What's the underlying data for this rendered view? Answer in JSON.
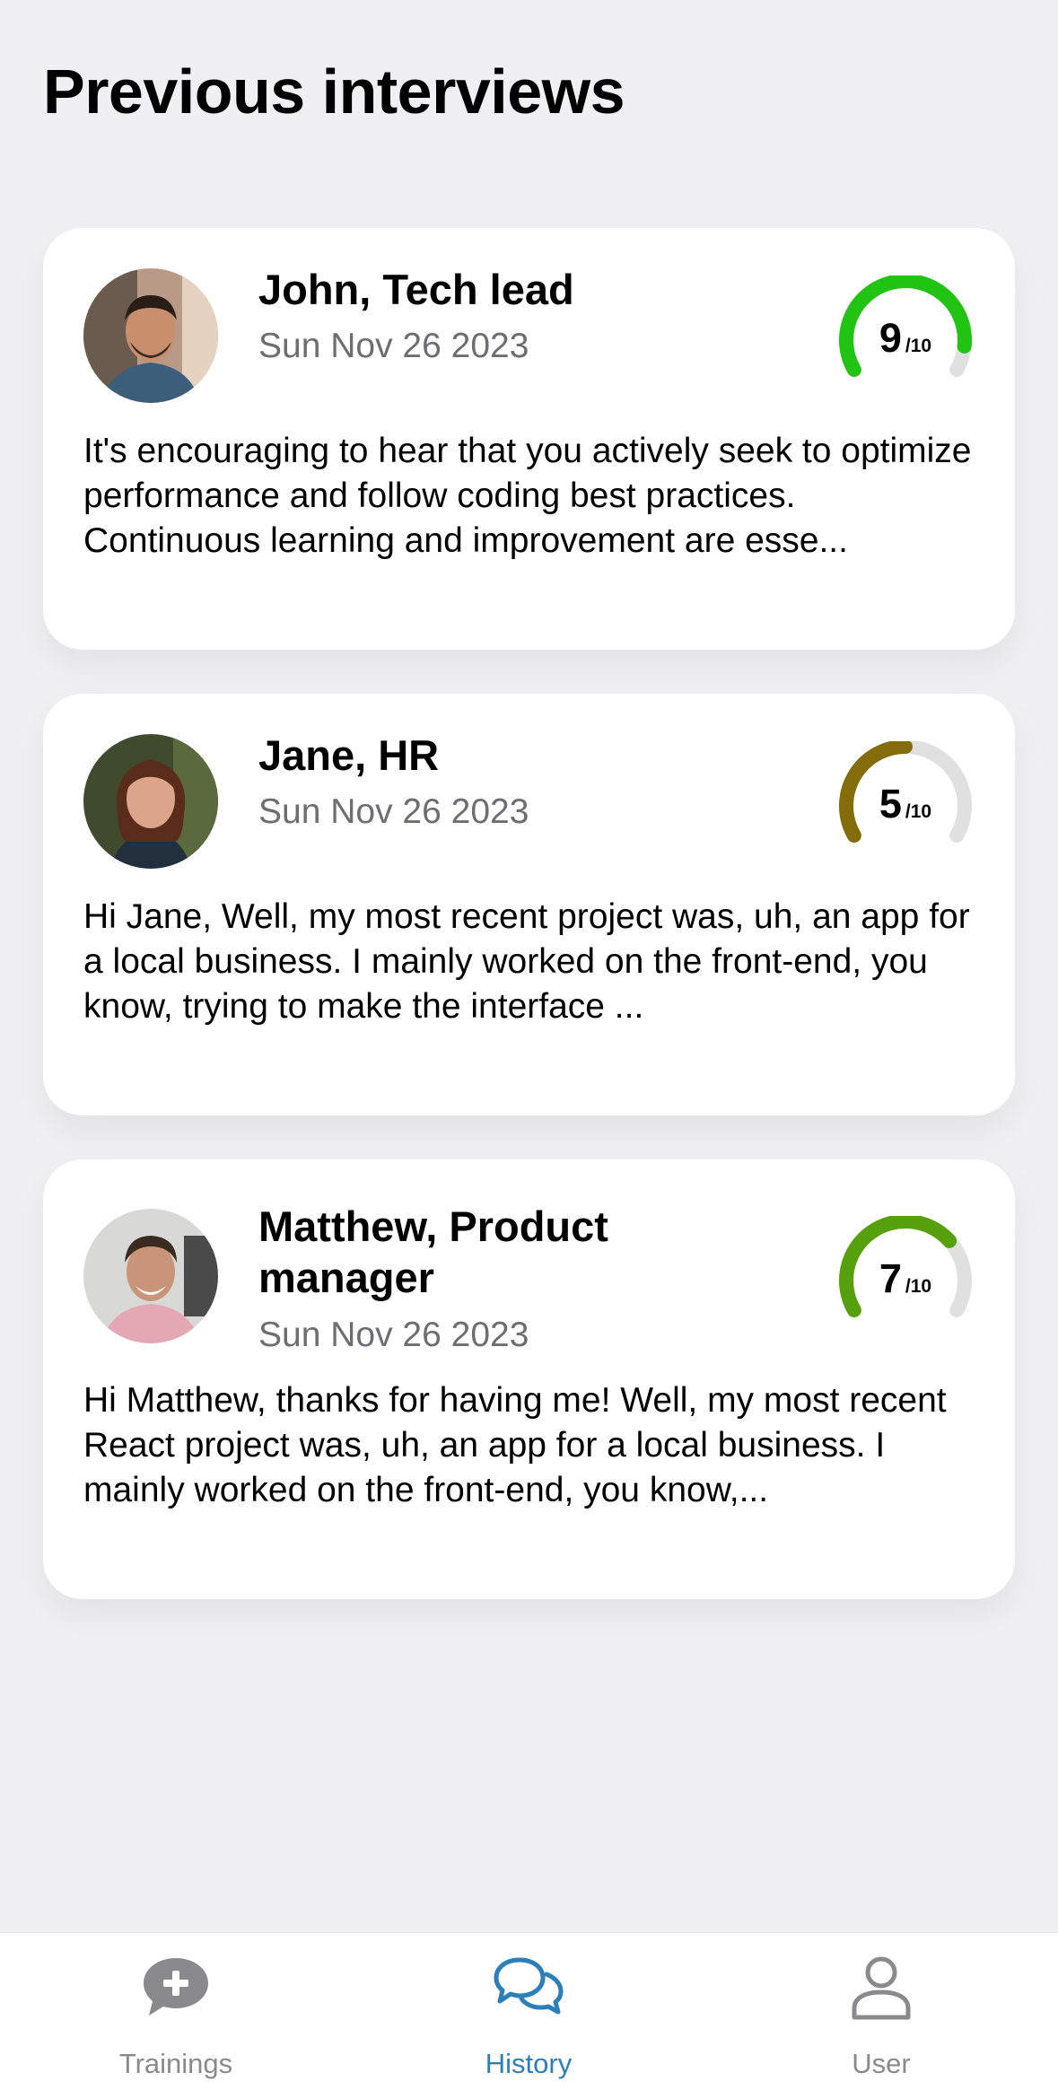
{
  "header": {
    "title": "Previous interviews"
  },
  "interviews": [
    {
      "name": "John, Tech lead",
      "date": "Sun Nov 26 2023",
      "score": "9",
      "score_max": "/10",
      "score_fraction": 0.9,
      "gauge_color": "#22c414",
      "snippet": "It's encouraging to hear that you actively seek to optimize performance and follow coding best practices. Continuous learning and improvement are esse..."
    },
    {
      "name": "Jane, HR",
      "date": "Sun Nov 26 2023",
      "score": "5",
      "score_max": "/10",
      "score_fraction": 0.5,
      "gauge_color": "#856c0a",
      "snippet": "Hi Jane,  Well, my most recent project was, uh, an app for a local business. I mainly worked on the front-end, you know, trying to make the interface ..."
    },
    {
      "name": "Matthew, Product manager",
      "date": "Sun Nov 26 2023",
      "score": "7",
      "score_max": "/10",
      "score_fraction": 0.7,
      "gauge_color": "#55a00c",
      "snippet": "Hi Matthew, thanks for having me! Well, my most recent React project was, uh, an app for a local business. I mainly worked on the front-end, you know,..."
    }
  ],
  "tabbar": {
    "items": [
      {
        "label": "Trainings",
        "icon": "chat-plus-icon",
        "active": false
      },
      {
        "label": "History",
        "icon": "chat-bubbles-icon",
        "active": true
      },
      {
        "label": "User",
        "icon": "user-icon",
        "active": false
      }
    ],
    "active_color": "#2c7fb8",
    "inactive_color": "#8a8a8e"
  },
  "colors": {
    "background": "#f0f0f2",
    "card": "#ffffff",
    "gauge_track": "#e0e0e0"
  }
}
